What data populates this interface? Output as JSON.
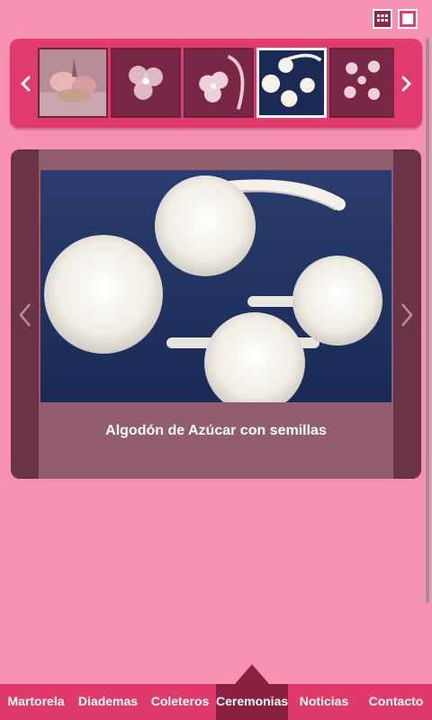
{
  "toolbar": {
    "grid_view_icon": "grid-icon",
    "single_view_icon": "square-icon"
  },
  "thumbnails": {
    "prev_icon": "chevron-left-icon",
    "next_icon": "chevron-right-icon",
    "items": [
      {
        "name": "flower-bunch",
        "selected": false
      },
      {
        "name": "white-flower-clip",
        "selected": false
      },
      {
        "name": "flower-headband",
        "selected": false
      },
      {
        "name": "pompom-set",
        "selected": true
      },
      {
        "name": "small-flowers",
        "selected": false
      }
    ]
  },
  "viewer": {
    "caption": "Algodón de Azúcar con semillas",
    "prev_icon": "chevron-left-icon",
    "next_icon": "chevron-right-icon"
  },
  "nav": {
    "items": [
      {
        "label": "Martorela"
      },
      {
        "label": "Diademas"
      },
      {
        "label": "Coleteros"
      },
      {
        "label": "Ceremonias",
        "active": true
      },
      {
        "label": "Noticias"
      },
      {
        "label": "Contacto"
      }
    ]
  },
  "colors": {
    "background": "#f791b2",
    "accent": "#e13b6d",
    "active_nav": "#8a2140",
    "viewer_bg": "#925d6c"
  }
}
